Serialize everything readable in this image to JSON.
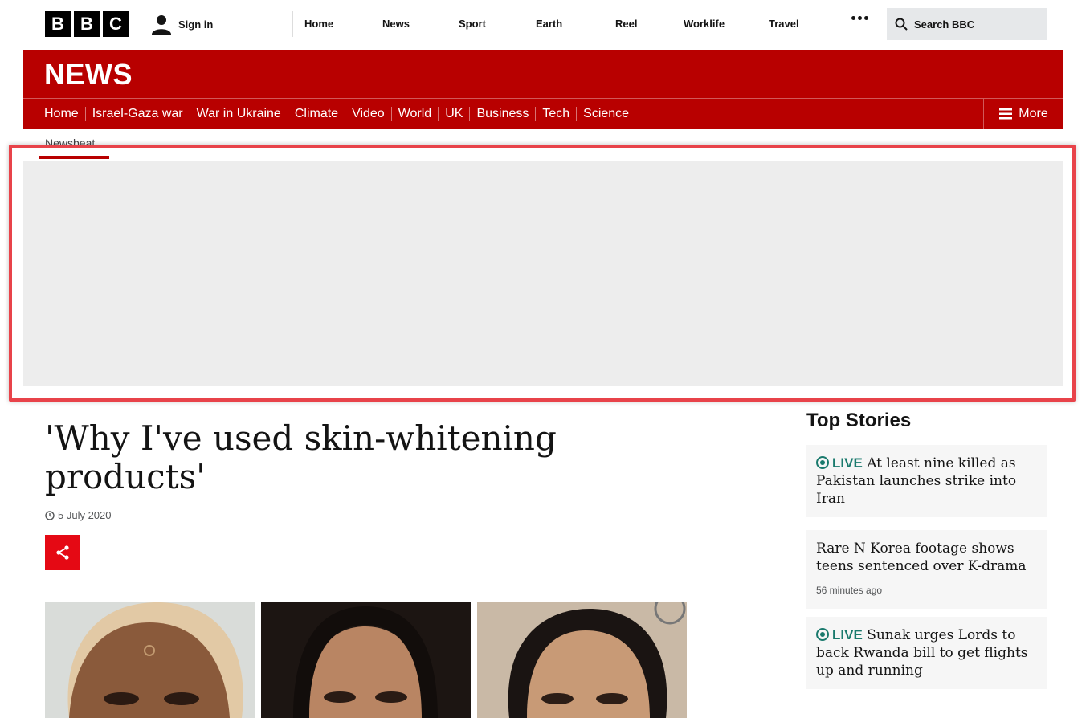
{
  "global_nav": {
    "logo_letters": [
      "B",
      "B",
      "C"
    ],
    "sign_in": "Sign in",
    "items": [
      "Home",
      "News",
      "Sport",
      "Earth",
      "Reel",
      "Worklife",
      "Travel"
    ],
    "search_placeholder": "Search BBC"
  },
  "news_banner": {
    "logo": "NEWS",
    "nav": [
      "Home",
      "Israel-Gaza war",
      "War in Ukraine",
      "Climate",
      "Video",
      "World",
      "UK",
      "Business",
      "Tech",
      "Science"
    ],
    "more": "More"
  },
  "subnav": {
    "active": "Newsbeat"
  },
  "article": {
    "headline": "'Why I've used skin-whitening products'",
    "date": "5 July 2020"
  },
  "top_stories": {
    "title": "Top Stories",
    "items": [
      {
        "live": "LIVE",
        "headline": "At least nine killed as Pakistan launches strike into Iran",
        "time": ""
      },
      {
        "live": "",
        "headline": "Rare N Korea footage shows teens sentenced over K-drama",
        "time": "56 minutes ago"
      },
      {
        "live": "LIVE",
        "headline": "Sunak urges Lords to back Rwanda bill to get flights up and running",
        "time": ""
      }
    ]
  },
  "colors": {
    "brand_red": "#b80000",
    "share_red": "#e50914",
    "live_green": "#1a7a6d",
    "highlight": "#e8434a"
  }
}
